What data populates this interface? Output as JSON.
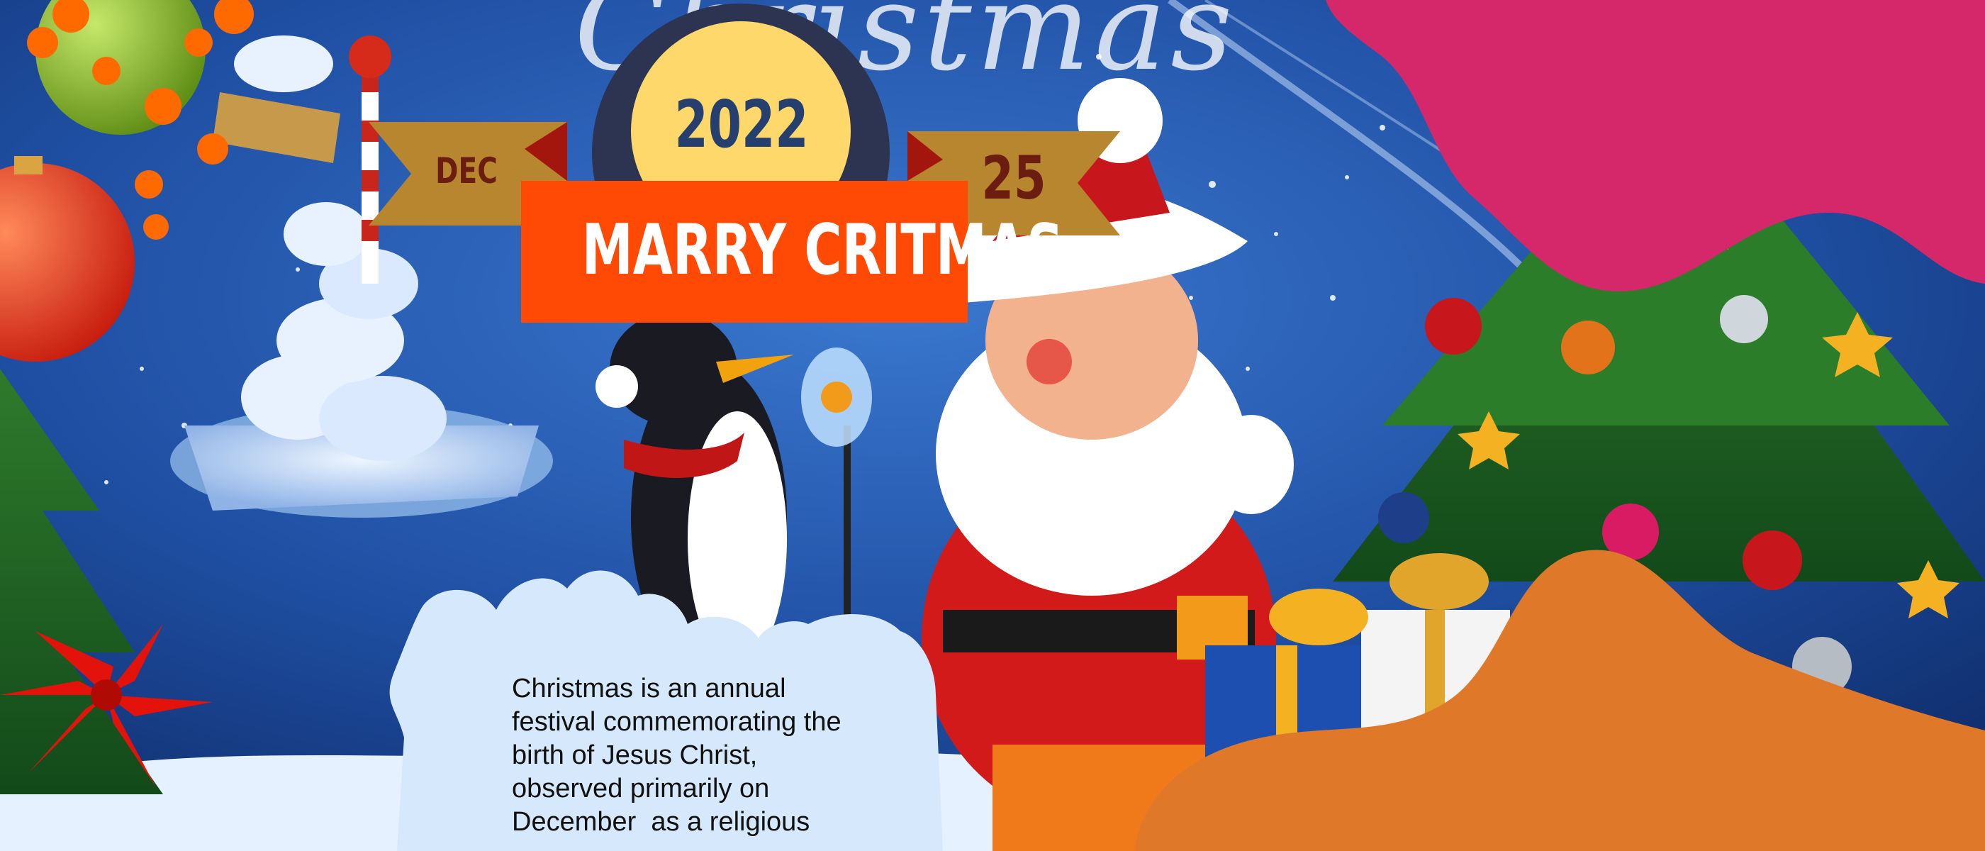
{
  "banner": {
    "year": "2022",
    "month": "DEC",
    "day": "25",
    "title": "MARRY CRITMAS"
  },
  "background": {
    "script_text": "Christmas"
  },
  "description": {
    "lines": [
      "Christmas is an annual",
      "festival commemorating the",
      "birth of Jesus Christ,",
      "observed primarily on",
      "December  as a religious"
    ]
  },
  "colors": {
    "sky": "#1f4fa3",
    "ribbon_gold": "#b8862e",
    "title_box": "#ff4a05",
    "year_circle": "#ffd86b",
    "year_ring": "#2c3452",
    "magenta_blob": "#d4286a",
    "orange_blob": "#e0782a",
    "cloud": "#d6e8fb"
  }
}
